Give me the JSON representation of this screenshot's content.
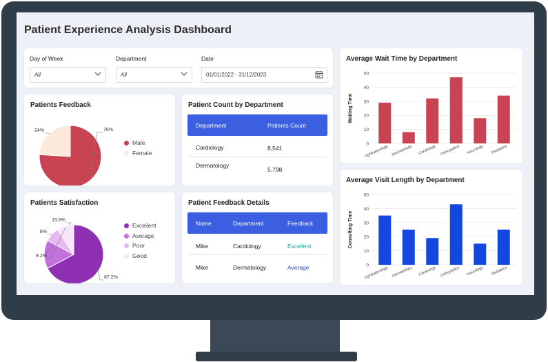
{
  "dashboard": {
    "title": "Patient Experience Analysis Dashboard"
  },
  "filters": {
    "day_of_week": {
      "label": "Day of Week",
      "value": "All"
    },
    "department": {
      "label": "Department",
      "value": "All"
    },
    "date": {
      "label": "Date",
      "value": "01/01/2022 - 31/12/2023"
    }
  },
  "colors": {
    "wait_bar": "#c94452",
    "visit_bar": "#1447e0",
    "male": "#c94452",
    "female": "#fbe9dc",
    "excellent": "#8e2fb4",
    "average": "#c470dc",
    "poor": "#e6b9f0",
    "good": "#f7e5fa",
    "table_header": "#3b5fe0",
    "feedback_excellent": "#16a2a0",
    "feedback_average": "#2a4ab8"
  },
  "patients_feedback": {
    "title": "Patients Feedback",
    "legend": [
      "Male",
      "Female"
    ]
  },
  "patients_satisfaction": {
    "title": "Patients Satisfaction",
    "legend": [
      "Excellent",
      "Average",
      "Poor",
      "Good"
    ]
  },
  "patient_count": {
    "title": "Patient Count by Department",
    "headers": [
      "Department",
      "Patients Count"
    ],
    "rows": [
      {
        "department": "Cardiology",
        "count": "8,541"
      },
      {
        "department": "Dermatology",
        "count": "5,798"
      }
    ]
  },
  "feedback_details": {
    "title": "Patient Feedback Details",
    "headers": [
      "Name",
      "Department",
      "Feedback"
    ],
    "rows": [
      {
        "name": "Mike",
        "department": "Cardiology",
        "feedback": "Excellent"
      },
      {
        "name": "Mike",
        "department": "Dermatology",
        "feedback": "Average"
      }
    ]
  },
  "wait_chart": {
    "title": "Average Wait Time by Department",
    "ylabel": "Waiting Time"
  },
  "visit_chart": {
    "title": "Average Visit Length by Department",
    "ylabel": "Consulting Time"
  },
  "chart_data": [
    {
      "type": "pie",
      "labels": [
        "Male",
        "Female"
      ],
      "values": [
        76,
        24
      ],
      "value_labels": [
        "76%",
        "24%"
      ]
    },
    {
      "type": "pie",
      "labels": [
        "Excellent",
        "Average",
        "Poor",
        "Good"
      ],
      "values": [
        67.2,
        15.6,
        8,
        9.2
      ],
      "value_labels": [
        "67.2%",
        "15.6%",
        "8%",
        "9.2%"
      ]
    },
    {
      "type": "bar",
      "title": "Average Wait Time by Department",
      "ylabel": "Waiting Time",
      "categories": [
        "Ophthalmology",
        "Dermatology",
        "Cardiology",
        "Orthopedics",
        "Neurology",
        "Pediatrics"
      ],
      "values": [
        29,
        8,
        32,
        47,
        18,
        34
      ],
      "ylim": [
        0,
        50
      ],
      "yticks": [
        0,
        10,
        20,
        30,
        40,
        50
      ],
      "grid": true
    },
    {
      "type": "bar",
      "title": "Average Visit Length by Department",
      "ylabel": "Consulting Time",
      "categories": [
        "Ophthalmology",
        "Dermatology",
        "Cardiology",
        "Orthopedics",
        "Neurology",
        "Pediatrics"
      ],
      "values": [
        35,
        25,
        19,
        43,
        15,
        25
      ],
      "ylim": [
        0,
        50
      ],
      "yticks": [
        0,
        10,
        20,
        30,
        40,
        50
      ],
      "grid": true
    }
  ]
}
